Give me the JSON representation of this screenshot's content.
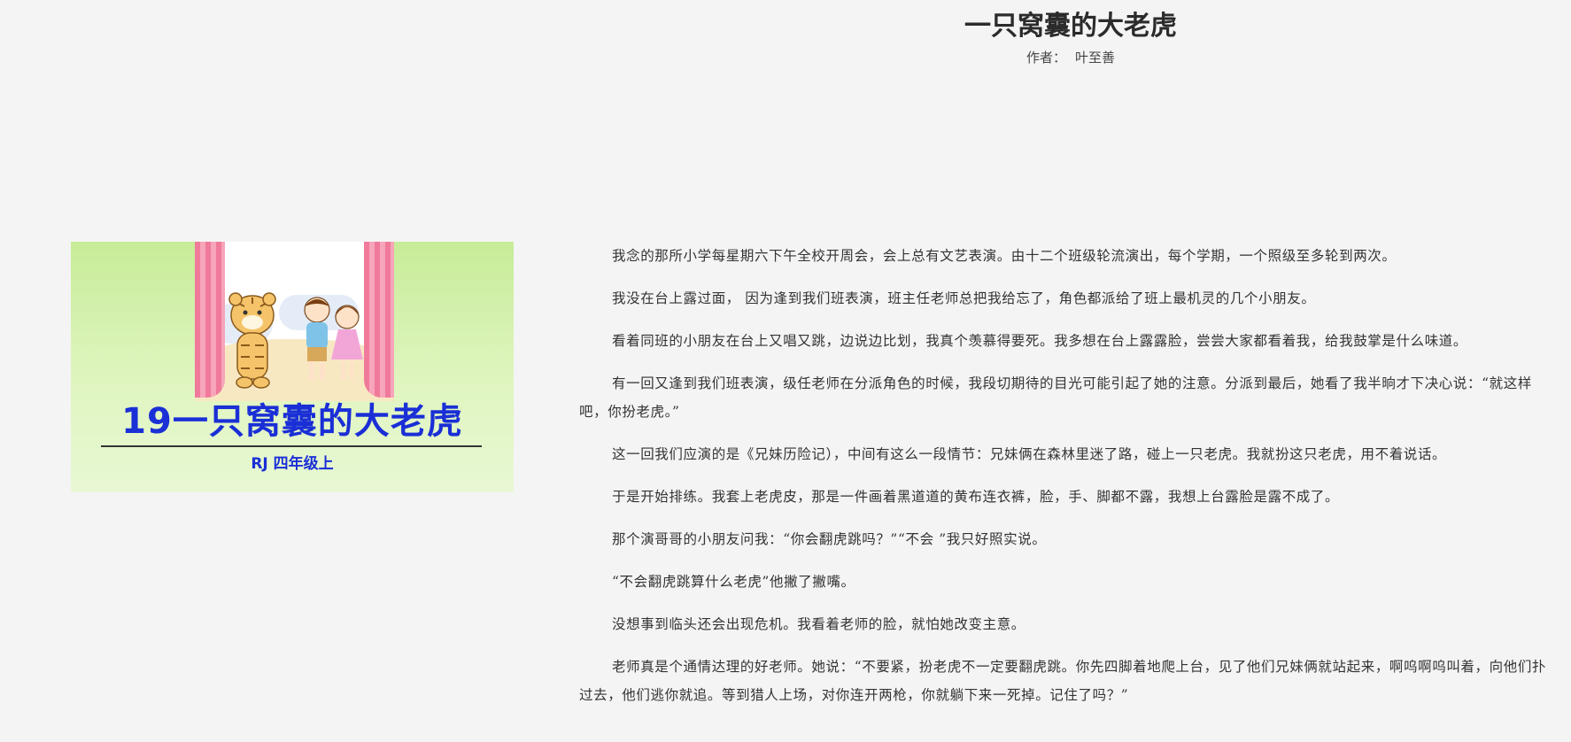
{
  "header": {
    "title": "一只窝囊的大老虎",
    "author_label": "作者：",
    "author_name": "叶至善"
  },
  "cover": {
    "title": "19一只窝囊的大老虎",
    "subtitle": "RJ  四年级上",
    "title_color": "#1a2fd6"
  },
  "article": {
    "paragraphs": [
      "我念的那所小学每星期六下午全校开周会，会上总有文艺表演。由十二个班级轮流演出，每个学期，一个照级至多轮到两次。",
      "我没在台上露过面，  因为逢到我们班表演，班主任老师总把我给忘了，角色都派给了班上最机灵的几个小朋友。",
      "看着同班的小朋友在台上又唱又跳，边说边比划，我真个羡慕得要死。我多想在台上露露脸，尝尝大家都看着我，给我鼓掌是什么味道。",
      "有一回又逢到我们班表演，级任老师在分派角色的时候，我段切期待的目光可能引起了她的注意。分派到最后，她看了我半晌才下决心说：“就这样吧，你扮老虎。”",
      "这一回我们应演的是《兄妹历险记），中间有这么一段情节：兄妹俩在森林里迷了路，碰上一只老虎。我就扮这只老虎，用不着说话。",
      "于是开始排练。我套上老虎皮，那是一件画着黑道道的黄布连衣裤，脸，手、脚都不露，我想上台露脸是露不成了。",
      "那个演哥哥的小朋友问我：“你会翻虎跳吗？”“不会 ”我只好照实说。",
      "“不会翻虎跳算什么老虎”他撇了撇嘴。",
      "没想事到临头还会出现危机。我看着老师的脸，就怕她改变主意。",
      "老师真是个通情达理的好老师。她说：“不要紧，扮老虎不一定要翻虎跳。你先四脚着地爬上台，见了他们兄妹俩就站起来，啊呜啊呜叫着，向他们扑过去，他们逃你就追。等到猎人上场，对你连开两枪，你就躺下来一死掉。记住了吗？”"
    ]
  }
}
